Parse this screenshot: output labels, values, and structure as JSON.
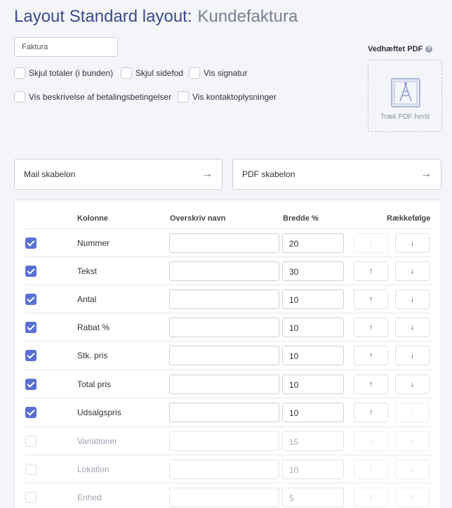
{
  "header": {
    "title": "Layout Standard layout:",
    "subtitle": "Kundefaktura"
  },
  "name_field": {
    "value": "Faktura"
  },
  "options": [
    {
      "label": "Skjul totaler (i bunden)",
      "checked": false
    },
    {
      "label": "Skjul sidefod",
      "checked": false
    },
    {
      "label": "Vis signatur",
      "checked": false
    },
    {
      "label": "Vis beskrivelse af betalingsbetingelser",
      "checked": false
    },
    {
      "label": "Vis kontaktoplysninger",
      "checked": false
    }
  ],
  "attached_pdf": {
    "label": "Vedhæftet PDF",
    "help_icon": "?",
    "drop_text": "Træk PDF hertil",
    "icon": "image-icon"
  },
  "templates": {
    "mail": "Mail skabelon",
    "pdf": "PDF skabelon",
    "arrow": "→"
  },
  "table": {
    "headers": {
      "column": "Kolonne",
      "rename": "Overskriv navn",
      "width": "Bredde %",
      "order": "Rækkefølge"
    },
    "order_buttons": {
      "up": "↑",
      "down": "↓"
    },
    "rows": [
      {
        "label": "Nummer",
        "checked": true,
        "width": "20",
        "up_enabled": false,
        "down_enabled": true
      },
      {
        "label": "Tekst",
        "checked": true,
        "width": "30",
        "up_enabled": true,
        "down_enabled": true
      },
      {
        "label": "Antal",
        "checked": true,
        "width": "10",
        "up_enabled": true,
        "down_enabled": true
      },
      {
        "label": "Rabat %",
        "checked": true,
        "width": "10",
        "up_enabled": true,
        "down_enabled": true
      },
      {
        "label": "Stk. pris",
        "checked": true,
        "width": "10",
        "up_enabled": true,
        "down_enabled": true
      },
      {
        "label": "Total pris",
        "checked": true,
        "width": "10",
        "up_enabled": true,
        "down_enabled": true
      },
      {
        "label": "Udsalgspris",
        "checked": true,
        "width": "10",
        "up_enabled": true,
        "down_enabled": false
      },
      {
        "label": "Variationer",
        "checked": false,
        "width": "15",
        "up_enabled": false,
        "down_enabled": false
      },
      {
        "label": "Lokation",
        "checked": false,
        "width": "10",
        "up_enabled": false,
        "down_enabled": false
      },
      {
        "label": "Enhed",
        "checked": false,
        "width": "5",
        "up_enabled": false,
        "down_enabled": false
      }
    ]
  },
  "colors": {
    "accent": "#5a6fd6",
    "title": "#3b4a8c",
    "subtitle": "#7a7f93",
    "background": "#f4f5f9"
  }
}
